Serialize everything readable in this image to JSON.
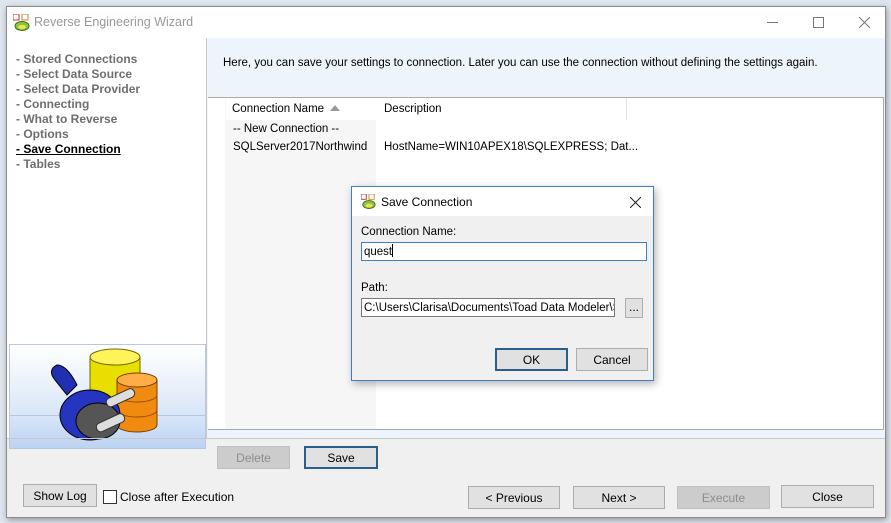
{
  "window": {
    "title": "Reverse Engineering Wizard",
    "minimize_icon": "minimize-icon",
    "maximize_icon": "maximize-icon",
    "close_icon": "close-icon"
  },
  "nav": {
    "items": [
      {
        "label": "- Stored Connections",
        "active": false
      },
      {
        "label": "- Select Data Source",
        "active": false
      },
      {
        "label": "- Select Data Provider",
        "active": false
      },
      {
        "label": "- Connecting",
        "active": false
      },
      {
        "label": "- What to Reverse",
        "active": false
      },
      {
        "label": "- Options",
        "active": false
      },
      {
        "label": "- Save Connection",
        "active": true
      },
      {
        "label": "- Tables",
        "active": false
      }
    ]
  },
  "main": {
    "info_text": "Here, you can save your settings to connection. Later you can use the connection without defining the settings again.",
    "grid": {
      "columns": [
        {
          "label": "Connection Name",
          "sorted": "ascending"
        },
        {
          "label": "Description"
        }
      ],
      "rows": [
        {
          "name": "-- New Connection --",
          "description": ""
        },
        {
          "name": "SQLServer2017Northwind",
          "description": "HostName=WIN10APEX18\\SQLEXPRESS; Dat..."
        }
      ]
    },
    "delete_label": "Delete",
    "save_label": "Save"
  },
  "footer": {
    "show_log_label": "Show Log",
    "close_after_label": "Close after Execution",
    "close_after_checked": false,
    "previous_label": "< Previous",
    "next_label": "Next >",
    "execute_label": "Execute",
    "close_label": "Close"
  },
  "dialog": {
    "title": "Save Connection",
    "name_label": "Connection Name:",
    "name_value": "quest",
    "path_label": "Path:",
    "path_value": "C:\\Users\\Clarisa\\Documents\\Toad Data Modeler\\St",
    "browse_label": "...",
    "ok_label": "OK",
    "cancel_label": "Cancel"
  }
}
